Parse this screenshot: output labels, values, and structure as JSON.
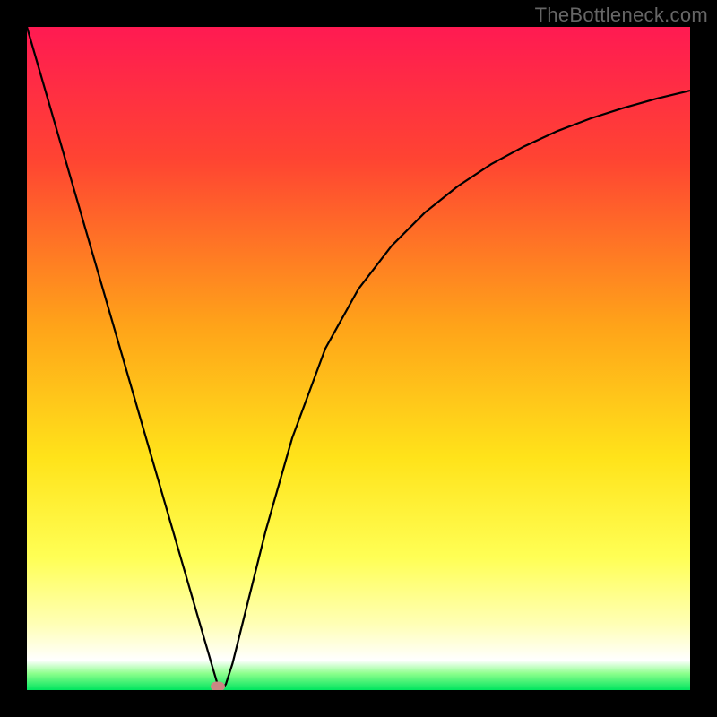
{
  "watermark": "TheBottleneck.com",
  "colors": {
    "frame": "#000000",
    "gradient_stops": [
      {
        "offset": 0.0,
        "color": "#ff1a52"
      },
      {
        "offset": 0.2,
        "color": "#ff4432"
      },
      {
        "offset": 0.45,
        "color": "#ffa319"
      },
      {
        "offset": 0.65,
        "color": "#ffe31a"
      },
      {
        "offset": 0.8,
        "color": "#ffff55"
      },
      {
        "offset": 0.9,
        "color": "#ffffb5"
      },
      {
        "offset": 0.955,
        "color": "#ffffff"
      },
      {
        "offset": 0.975,
        "color": "#8cff8c"
      },
      {
        "offset": 1.0,
        "color": "#00e55f"
      }
    ],
    "curve": "#000000",
    "marker": "#ca8783"
  },
  "chart_data": {
    "type": "line",
    "title": "",
    "xlabel": "",
    "ylabel": "",
    "xlim": [
      0,
      100
    ],
    "ylim": [
      0,
      100
    ],
    "x": [
      0,
      2,
      4,
      6,
      8,
      10,
      12,
      14,
      16,
      18,
      20,
      22,
      24,
      26,
      28,
      28.8,
      29.5,
      30,
      31,
      33,
      36,
      40,
      45,
      50,
      55,
      60,
      65,
      70,
      75,
      80,
      85,
      90,
      95,
      100
    ],
    "values": [
      100,
      93.1,
      86.2,
      79.3,
      72.4,
      65.5,
      58.6,
      51.7,
      44.8,
      37.9,
      31.0,
      24.1,
      17.2,
      10.3,
      3.4,
      0.7,
      0.2,
      0.9,
      4.0,
      12.0,
      24.0,
      38.0,
      51.5,
      60.5,
      67.0,
      72.0,
      76.0,
      79.3,
      82.0,
      84.3,
      86.2,
      87.8,
      89.2,
      90.4
    ],
    "notes": "x is relative position across the plot (0-100), values is curve height from bottom (0 = green/bottom, 100 = red/top). Minimum at ~x=29.",
    "marker": {
      "x": 28.8,
      "y": 0.6
    }
  }
}
